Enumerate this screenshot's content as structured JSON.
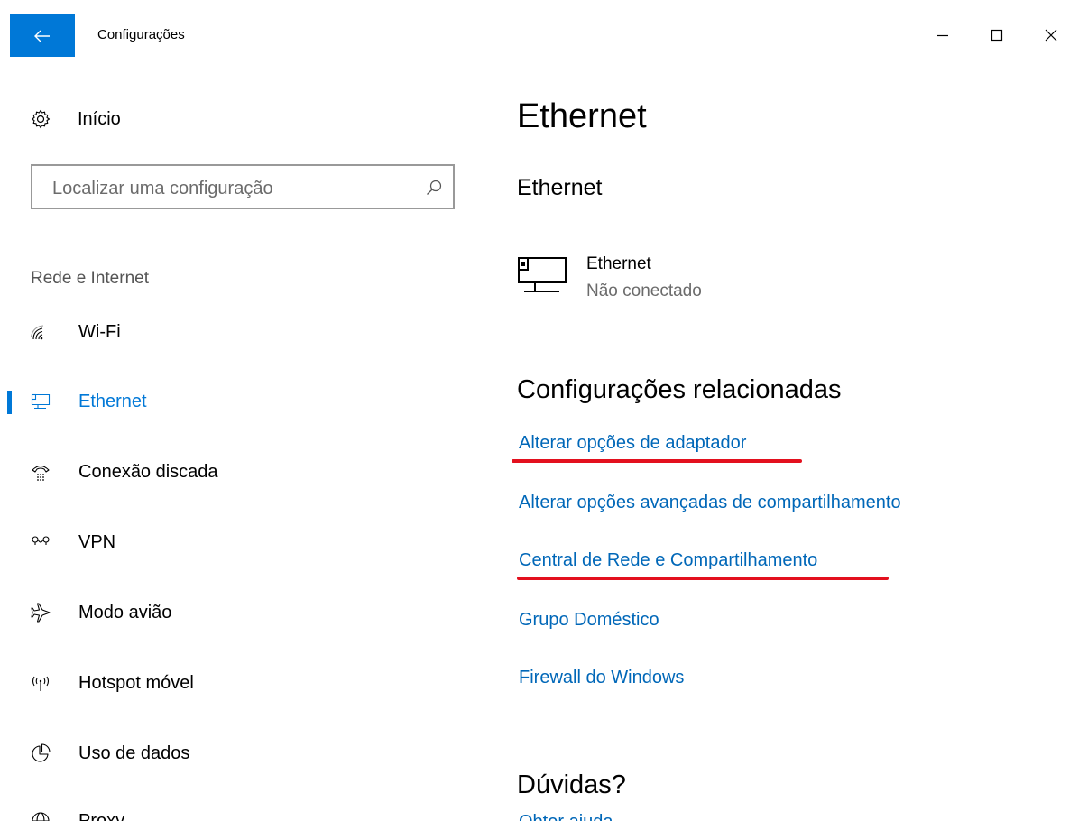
{
  "titlebar": {
    "app_title": "Configurações"
  },
  "sidebar": {
    "home_label": "Início",
    "search": {
      "placeholder": "Localizar uma configuração",
      "value": ""
    },
    "section_label": "Rede e Internet",
    "items": [
      {
        "label": "Wi-Fi",
        "icon": "wifi-icon",
        "selected": false
      },
      {
        "label": "Ethernet",
        "icon": "ethernet-icon",
        "selected": true
      },
      {
        "label": "Conexão discada",
        "icon": "dialup-icon",
        "selected": false
      },
      {
        "label": "VPN",
        "icon": "vpn-icon",
        "selected": false
      },
      {
        "label": "Modo avião",
        "icon": "airplane-icon",
        "selected": false
      },
      {
        "label": "Hotspot móvel",
        "icon": "hotspot-icon",
        "selected": false
      },
      {
        "label": "Uso de dados",
        "icon": "data-usage-icon",
        "selected": false
      },
      {
        "label": "Proxy",
        "icon": "proxy-icon",
        "selected": false
      }
    ]
  },
  "main": {
    "page_title": "Ethernet",
    "sub_title": "Ethernet",
    "adapter": {
      "name": "Ethernet",
      "status": "Não conectado"
    },
    "related_title": "Configurações relacionadas",
    "links": [
      "Alterar opções de adaptador",
      "Alterar opções avançadas de compartilhamento",
      "Central de Rede e Compartilhamento",
      "Grupo Doméstico",
      "Firewall do Windows"
    ],
    "doubts_title": "Dúvidas?",
    "doubts_link": "Obter ajuda"
  },
  "colors": {
    "accent": "#0078d7",
    "link": "#0067b8",
    "annotation": "#e3101e"
  }
}
